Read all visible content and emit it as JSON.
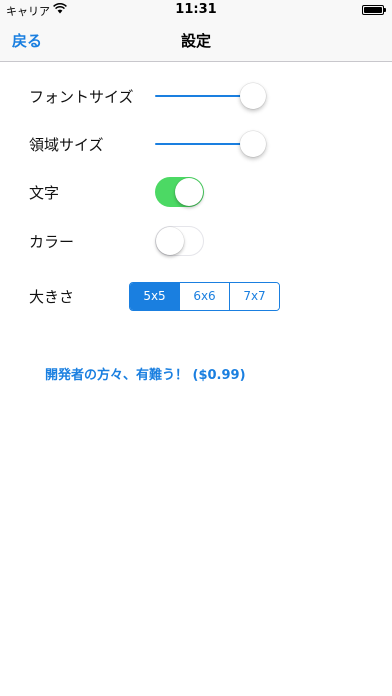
{
  "status_bar": {
    "carrier": "キャリア",
    "time": "11:31",
    "wifi_icon": "wifi-icon",
    "battery_icon": "battery-icon"
  },
  "nav": {
    "back_label": "戻る",
    "title": "設定"
  },
  "settings": {
    "font_size": {
      "label": "フォントサイズ",
      "value": 0.9
    },
    "area_size": {
      "label": "領域サイズ",
      "value": 0.9
    },
    "text": {
      "label": "文字",
      "on": true
    },
    "color": {
      "label": "カラー",
      "on": false
    },
    "size": {
      "label": "大きさ",
      "options": [
        "5x5",
        "6x6",
        "7x7"
      ],
      "selected": "5x5"
    }
  },
  "donate": {
    "label": "開発者の方々、有難う！ ($0.99)"
  },
  "colors": {
    "accent": "#1a7fe0",
    "toggle_on": "#4cd964"
  }
}
